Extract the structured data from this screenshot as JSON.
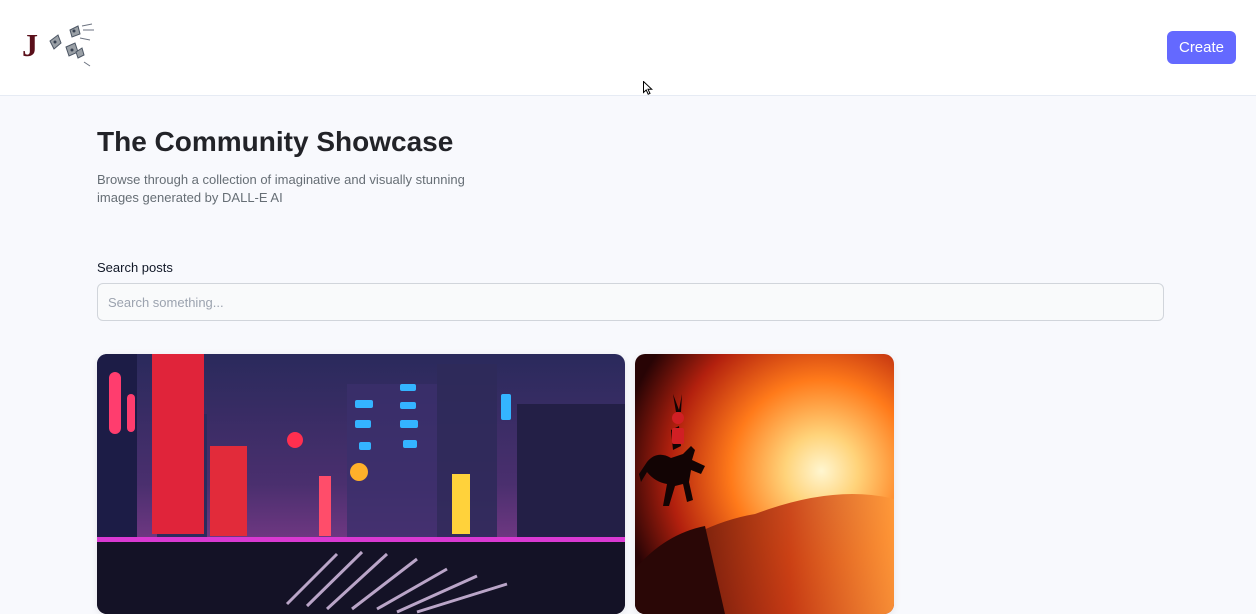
{
  "header": {
    "logo_letter": "J",
    "create_label": "Create"
  },
  "main": {
    "title": "The Community Showcase",
    "subtitle": "Browse through a collection of imaginative and visually stunning images generated by DALL-E AI",
    "search": {
      "label": "Search posts",
      "placeholder": "Search something...",
      "value": ""
    }
  },
  "posts": [
    {
      "image": "neon-city-scene"
    },
    {
      "image": "silhouette-rider-sunset"
    }
  ],
  "colors": {
    "accent": "#6469ff",
    "title": "#222328",
    "subtitle": "#666e75",
    "background": "#f8f9fd"
  }
}
